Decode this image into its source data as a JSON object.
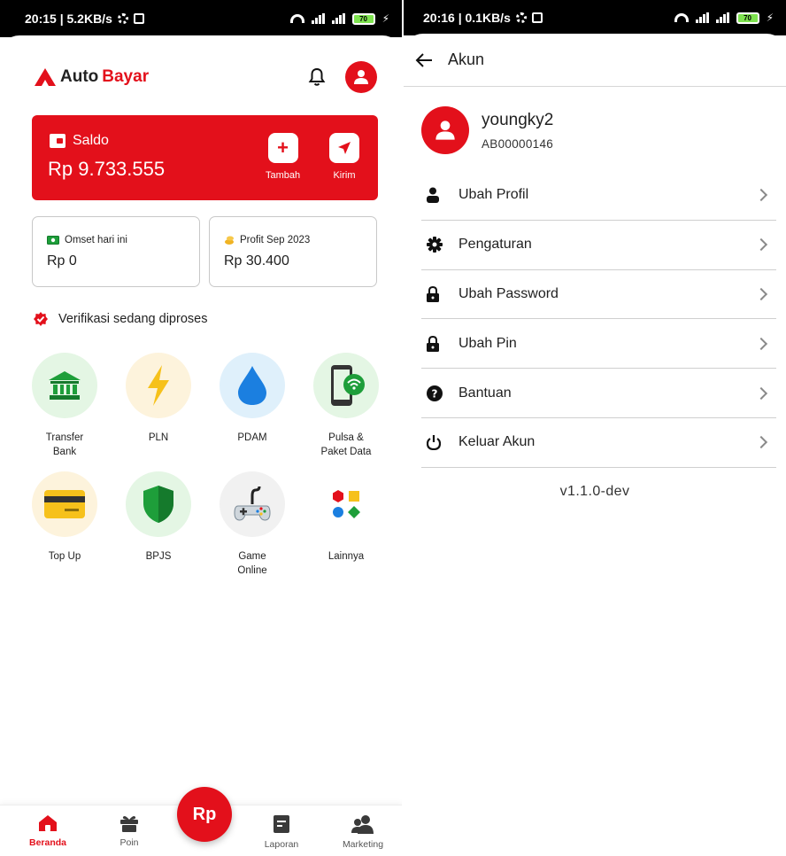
{
  "left": {
    "status": {
      "time": "20:15 | 5.2KB/s",
      "battery": "70"
    },
    "brand": {
      "part1": "Auto",
      "part2": "Bayar"
    },
    "saldo": {
      "label": "Saldo",
      "amount": "Rp 9.733.555",
      "tambah_label": "Tambah",
      "kirim_label": "Kirim"
    },
    "omset": {
      "title": "Omset hari ini",
      "value": "Rp 0"
    },
    "profit": {
      "title": "Profit Sep 2023",
      "value": "Rp 30.400"
    },
    "verification": "Verifikasi sedang diproses",
    "menu": [
      {
        "label": "Transfer\nBank",
        "icon": "bank-icon",
        "bg": "#e4f6e4"
      },
      {
        "label": "PLN",
        "icon": "lightning-icon",
        "bg": "#fdf3dc"
      },
      {
        "label": "PDAM",
        "icon": "water-drop-icon",
        "bg": "#dff0fb"
      },
      {
        "label": "Pulsa &\nPaket Data",
        "icon": "phone-wifi-icon",
        "bg": "#e4f6e4"
      },
      {
        "label": "Top Up",
        "icon": "card-icon",
        "bg": "#fdf3dc"
      },
      {
        "label": "BPJS",
        "icon": "shield-icon",
        "bg": "#e4f6e4"
      },
      {
        "label": "Game\nOnline",
        "icon": "gamepad-icon",
        "bg": "#f1f1f1"
      },
      {
        "label": "Lainnya",
        "icon": "shapes-icon",
        "bg": "#ffffff"
      }
    ],
    "nav": {
      "beranda": "Beranda",
      "poin": "Poin",
      "fab": "Rp",
      "laporan": "Laporan",
      "marketing": "Marketing"
    },
    "colors": {
      "brand": "#e3101b"
    }
  },
  "right": {
    "status": {
      "time": "20:16 | 0.1KB/s",
      "battery": "70"
    },
    "title": "Akun",
    "user": {
      "name": "youngky2",
      "id": "AB00000146"
    },
    "items": [
      {
        "label": "Ubah Profil",
        "icon": "person-icon"
      },
      {
        "label": "Pengaturan",
        "icon": "gear-icon"
      },
      {
        "label": "Ubah Password",
        "icon": "lock-icon"
      },
      {
        "label": "Ubah Pin",
        "icon": "lock-icon"
      },
      {
        "label": "Bantuan",
        "icon": "help-icon"
      },
      {
        "label": "Keluar Akun",
        "icon": "power-icon"
      }
    ],
    "version": "v1.1.0-dev"
  }
}
